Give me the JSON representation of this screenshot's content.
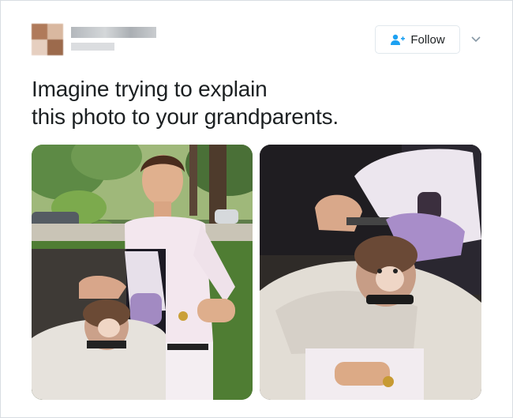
{
  "header": {
    "follow_label": "Follow",
    "icons": [
      "person-add-icon",
      "chevron-down-icon"
    ]
  },
  "tweet": {
    "text_line1": "Imagine trying to explain",
    "text_line2": "this photo to your grandparents."
  },
  "colors": {
    "follow_icon": "#1da1f2",
    "text": "#1c2022",
    "border": "#e1e8ed"
  }
}
